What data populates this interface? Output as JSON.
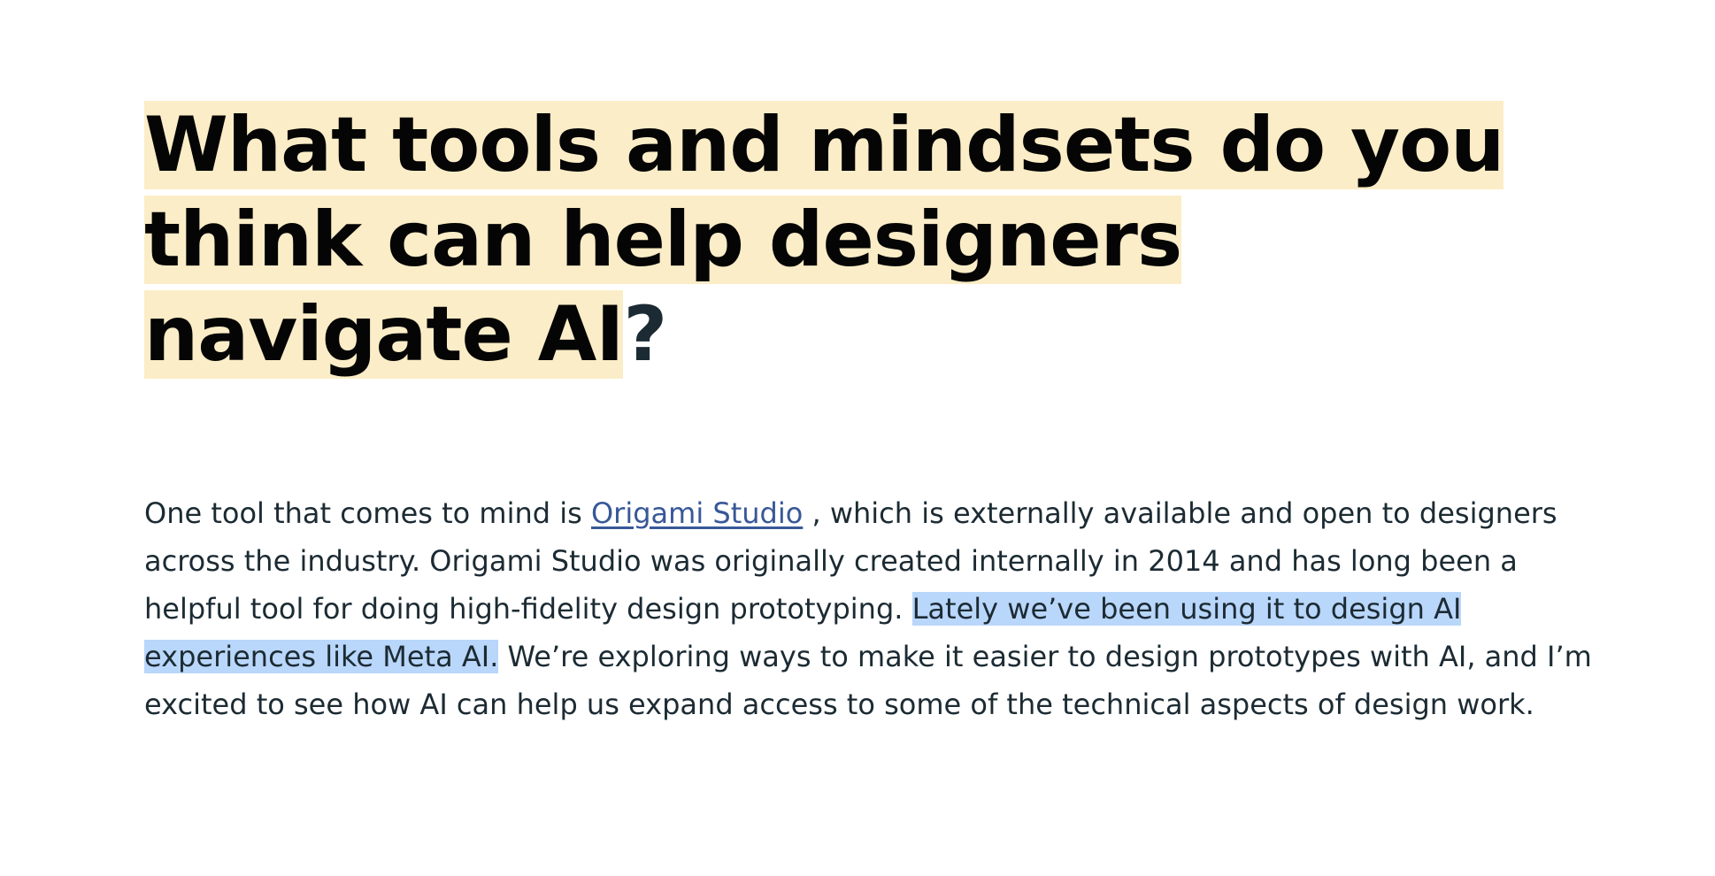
{
  "article": {
    "heading": {
      "highlighted": "What tools and mindsets do you think can help designers navigate AI",
      "tail": "?"
    },
    "paragraph": {
      "intro": "One tool that comes to mind is ",
      "link_text": "Origami Studio",
      "after_link": " , which is externally available and open to designers across the industry. Origami Studio was originally created internally in 2014 and has long been a helpful tool for doing high-fidelity design prototyping. ",
      "selected": "Lately we’ve been using it to design AI experiences like Meta AI.",
      "rest": " We’re exploring ways to make it easier to design prototypes with AI, and I’m excited to see how AI can help us expand access to some of the technical aspects of design work."
    },
    "colors": {
      "heading_highlight": "#fbedc7",
      "text_selection": "#b9d6fb",
      "link": "#385898",
      "body_text": "#1c2b33"
    }
  }
}
